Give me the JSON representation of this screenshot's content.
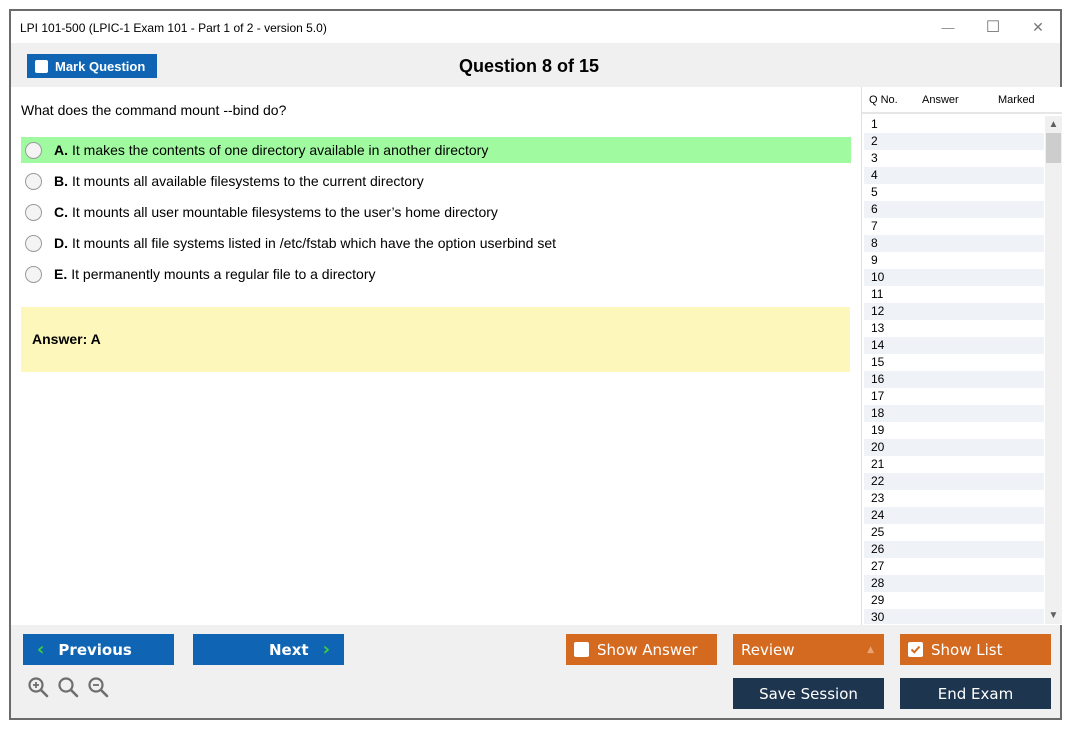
{
  "window": {
    "title": "LPI 101-500 (LPIC-1 Exam 101 - Part 1 of 2 - version 5.0)",
    "controls": {
      "minimize": "—",
      "maximize": "☐",
      "close": "✕"
    }
  },
  "header": {
    "mark_question_label": "Mark Question",
    "mark_question_checked": false,
    "question_counter": "Question 8 of 15"
  },
  "question": {
    "text": "What does the command mount --bind do?",
    "options": [
      {
        "letter": "A.",
        "text": "It makes the contents of one directory available in another directory",
        "highlighted": true
      },
      {
        "letter": "B.",
        "text": "It mounts all available filesystems to the current directory",
        "highlighted": false
      },
      {
        "letter": "C.",
        "text": "It mounts all user mountable filesystems to the user’s home directory",
        "highlighted": false
      },
      {
        "letter": "D.",
        "text": "It mounts all file systems listed in /etc/fstab which have the option userbind set",
        "highlighted": false
      },
      {
        "letter": "E.",
        "text": "It permanently mounts a regular file to a directory",
        "highlighted": false
      }
    ],
    "answer": "Answer: A"
  },
  "question_list": {
    "headers": {
      "qno": "Q No.",
      "answer": "Answer",
      "marked": "Marked"
    },
    "rows": [
      "1",
      "2",
      "3",
      "4",
      "5",
      "6",
      "7",
      "8",
      "9",
      "10",
      "11",
      "12",
      "13",
      "14",
      "15",
      "16",
      "17",
      "18",
      "19",
      "20",
      "21",
      "22",
      "23",
      "24",
      "25",
      "26",
      "27",
      "28",
      "29",
      "30"
    ],
    "scroll_up": "^",
    "scroll_down": "v"
  },
  "footer": {
    "previous_label": "Previous",
    "next_label": "Next",
    "show_answer_label": "Show Answer",
    "show_answer_checked": false,
    "review_label": "Review",
    "show_list_label": "Show List",
    "show_list_checked": true,
    "save_session_label": "Save Session",
    "end_exam_label": "End Exam",
    "zoom_icons": [
      "zoom-in-icon",
      "zoom-reset-icon",
      "zoom-out-icon"
    ]
  },
  "colors": {
    "primary_blue": "#0f65b4",
    "orange": "#d46a20",
    "dark_navy": "#1e354f",
    "correct_highlight": "#a0fba0",
    "answer_bg": "#fdf7bc",
    "chevron_green": "#3bd13b"
  }
}
